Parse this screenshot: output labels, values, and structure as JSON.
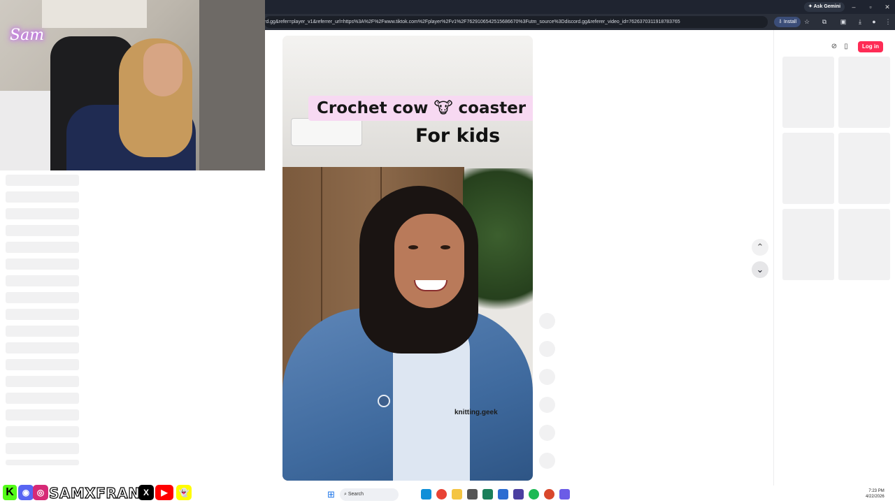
{
  "browser": {
    "ask_gemini_label": "Ask Gemini",
    "url": "rd.gg&refer=player_v1&referrer_url=https%3A%2F%2Fwww.tiktok.com%2Fplayer%2Fv1%2F7629106542515686670%3Futm_source%3Ddiscord.gg&referer_video_id=7626370311918783765",
    "install_label": "Install",
    "window_controls": [
      "–",
      "▫",
      "✕"
    ]
  },
  "webcam": {
    "logo_text": "Sam"
  },
  "video": {
    "caption_line1": "Crochet cow 🐮 coaster",
    "caption_line2": "For kids",
    "watermark": "knitting.geek"
  },
  "right_panel": {
    "login_label": "Log in"
  },
  "banner": {
    "kick_letter": "K",
    "channel_name": "SAMXFRANK",
    "x_letter": "X",
    "youtube_glyph": "▶",
    "discord_glyph": "◉",
    "instagram_glyph": "◎",
    "snapchat_glyph": "👻"
  },
  "taskbar": {
    "search_label": "Search",
    "time": "7:23 PM",
    "date": "4/22/2026"
  },
  "colors": {
    "tiktok_red": "#fe2c55",
    "install_blue": "#3b4d78",
    "kick_green": "#53fc18"
  }
}
